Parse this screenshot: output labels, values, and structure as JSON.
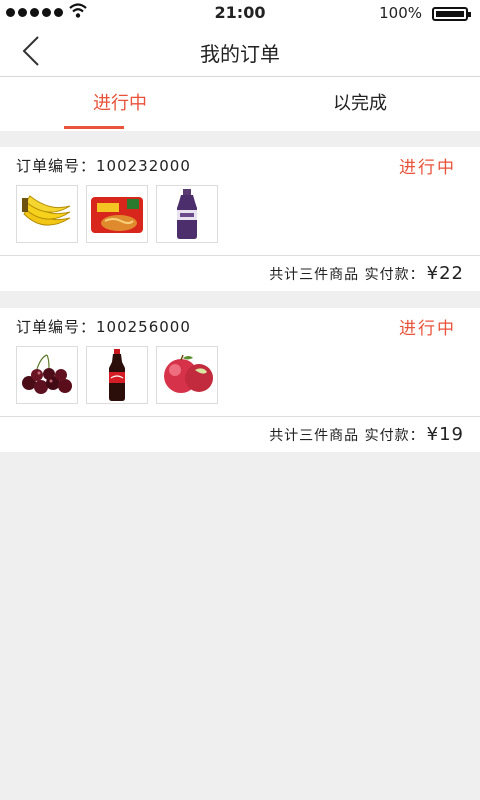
{
  "status_bar": {
    "time": "21:00",
    "battery": "100%"
  },
  "nav": {
    "title": "我的订单"
  },
  "tabs": [
    {
      "label": "进行中",
      "active": true
    },
    {
      "label": "以完成",
      "active": false
    }
  ],
  "colors": {
    "accent": "#e8533a",
    "background": "#efefef"
  },
  "orders": [
    {
      "number_label": "订单编号：100232000",
      "status": "进行中",
      "items": [
        "banana-image",
        "instant-noodles-image",
        "blueberry-juice-image"
      ],
      "summary": "共计三件商品  实付款：",
      "total": "¥22"
    },
    {
      "number_label": "订单编号：100256000",
      "status": "进行中",
      "items": [
        "cherries-image",
        "cola-bottle-image",
        "apple-image"
      ],
      "summary": "共计三件商品  实付款：",
      "total": "¥19"
    }
  ]
}
